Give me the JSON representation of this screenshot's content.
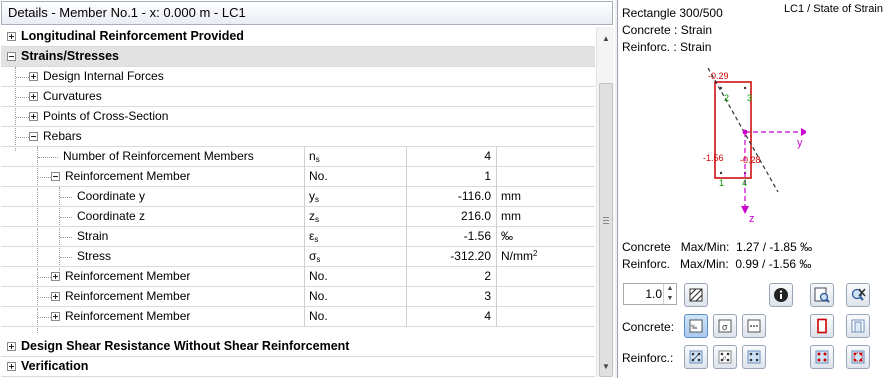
{
  "panel_title": "Details - Member No.1 - x: 0.000 m - LC1",
  "rows": [
    {
      "label": "Longitudinal Reinforcement Provided",
      "bold": true
    },
    {
      "label": "Strains/Stresses",
      "bold": true
    },
    {
      "label": "Design Internal Forces"
    },
    {
      "label": "Curvatures"
    },
    {
      "label": "Points of Cross-Section"
    },
    {
      "label": "Rebars"
    },
    {
      "label": "Number of Reinforcement Members",
      "sym": "n",
      "sym_sub": "s",
      "value": "4"
    },
    {
      "label": "Reinforcement Member",
      "sym": "No.",
      "value": "1"
    },
    {
      "label": "Coordinate y",
      "sym": "y",
      "sym_sub": "s",
      "value": "-116.0",
      "unit": "mm"
    },
    {
      "label": "Coordinate z",
      "sym": "z",
      "sym_sub": "s",
      "value": "216.0",
      "unit": "mm"
    },
    {
      "label": "Strain",
      "sym": "ε",
      "sym_sub": "s",
      "value": "-1.56",
      "unit": "‰"
    },
    {
      "label": "Stress",
      "sym": "σ",
      "sym_sub": "s",
      "value": "-312.20",
      "unit": "N/mm",
      "unit_sup": "2"
    },
    {
      "label": "Reinforcement Member",
      "sym": "No.",
      "value": "2"
    },
    {
      "label": "Reinforcement Member",
      "sym": "No.",
      "value": "3"
    },
    {
      "label": "Reinforcement Member",
      "sym": "No.",
      "value": "4"
    },
    {
      "label": "Design Shear Resistance Without Shear Reinforcement",
      "bold": true
    },
    {
      "label": "Verification",
      "bold": true
    }
  ],
  "right": {
    "section_name": "Rectangle 300/500",
    "load_case": "LC1 / State of Strain",
    "concrete_mode": "Concrete : Strain",
    "reinf_mode": "Reinforc. : Strain",
    "drawing": {
      "top_left": "-0.29",
      "bottom_left": "-1.56",
      "bottom_right": "-0.28",
      "bar2": "2",
      "bar3": "3",
      "bar1": "1",
      "bar4": "4",
      "axis_y": "y",
      "axis_z": "z",
      "colors": {
        "section": "#cc0000",
        "axis": "#cc00cc",
        "bar_label": "#009900",
        "neutral": "#333333"
      }
    },
    "concrete_maxmin": "Concrete   Max/Min:  1.27 / -1.85 ‰",
    "reinf_maxmin": "Reinforc.   Max/Min:  0.99 / -1.56 ‰",
    "scale_value": "1.0",
    "concrete_label": "Concrete:",
    "reinf_label": "Reinforc.:",
    "icons": {
      "row1": [
        "hatch-icon",
        "info-icon",
        "zoom-view-icon",
        "reset-view-icon"
      ],
      "row2": [
        "concrete-strain-icon",
        "concrete-stress-icon",
        "concrete-nodes-icon",
        "section-outline-icon",
        "section-fill-icon"
      ],
      "row3": [
        "rebar-strain-icon",
        "rebar-stress-icon",
        "rebar-nodes-icon",
        "rebar-outline-icon",
        "rebar-fill-icon"
      ]
    }
  }
}
